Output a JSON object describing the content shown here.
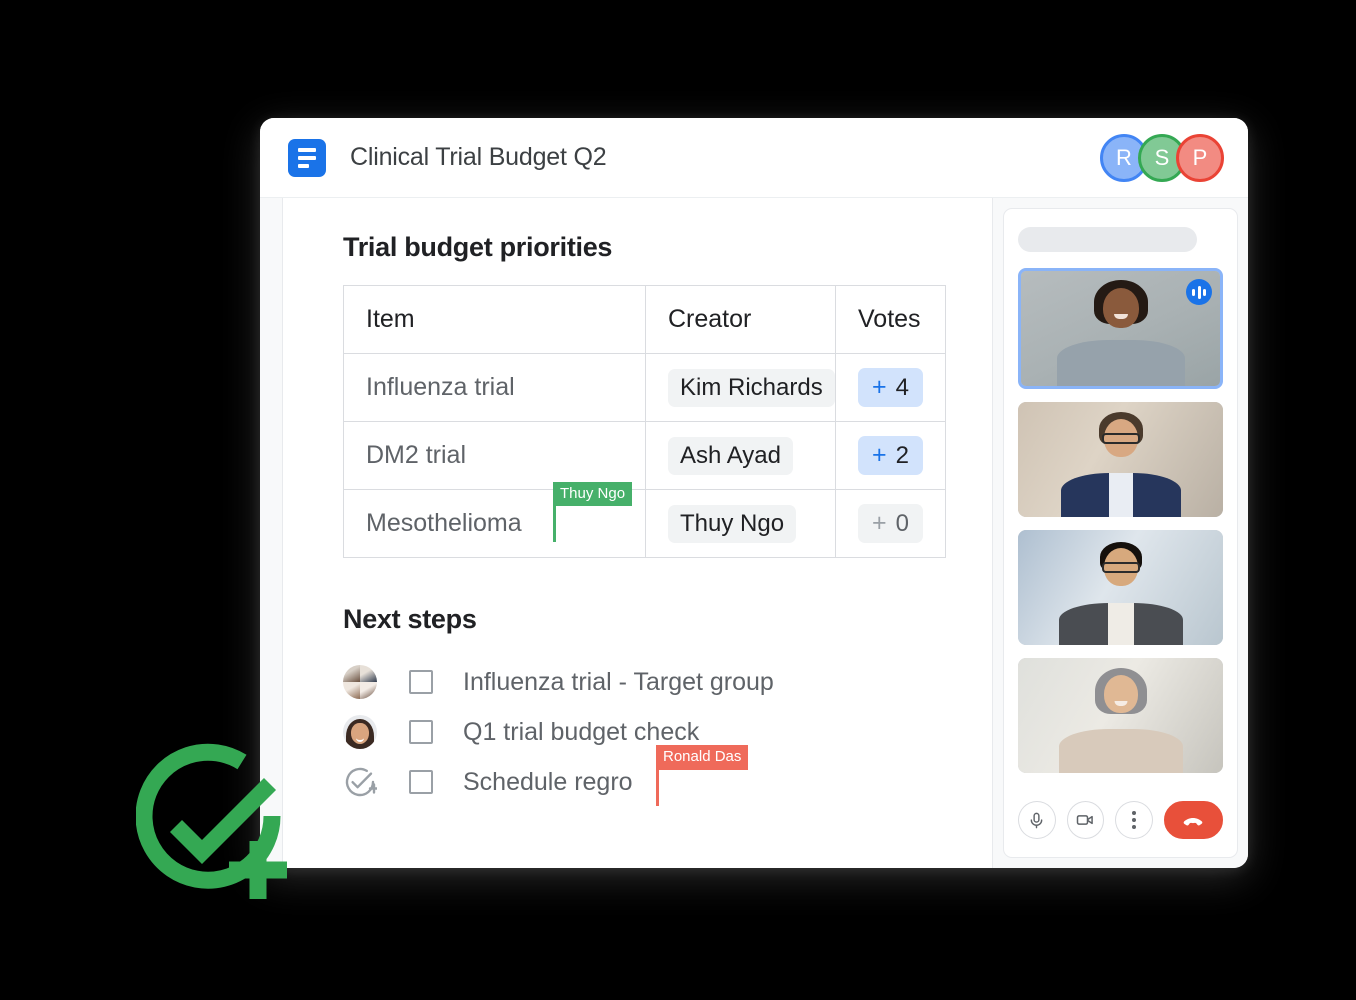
{
  "header": {
    "doc_icon": "google-docs-icon",
    "title": "Clinical Trial Budget Q2",
    "avatars": [
      {
        "initial": "R",
        "color": "#8ab4f8",
        "ring": "#4285f4"
      },
      {
        "initial": "S",
        "color": "#81c995",
        "ring": "#34a853"
      },
      {
        "initial": "P",
        "color": "#f28b82",
        "ring": "#ea4335"
      }
    ]
  },
  "document": {
    "section_title": "Trial budget priorities",
    "table": {
      "columns": [
        "Item",
        "Creator",
        "Votes"
      ],
      "rows": [
        {
          "item": "Influenza trial",
          "creator": "Kim Richards",
          "vote_plus": "+",
          "votes": "4",
          "votes_active": true
        },
        {
          "item": "DM2 trial",
          "creator": "Ash Ayad",
          "vote_plus": "+",
          "votes": "2",
          "votes_active": true
        },
        {
          "item": "Mesothelioma",
          "creator": "Thuy Ngo",
          "vote_plus": "+",
          "votes": "0",
          "votes_active": false
        }
      ]
    },
    "cursors": [
      {
        "name": "Thuy Ngo",
        "color": "#46b06a"
      },
      {
        "name": "Ronald Das",
        "color": "#ef6a5a"
      }
    ],
    "next_steps_title": "Next steps",
    "tasks": [
      {
        "label": "Influenza trial - Target group",
        "avatar": "group-avatar",
        "checked": false
      },
      {
        "label": "Q1 trial budget check",
        "avatar": "person-avatar",
        "checked": false
      },
      {
        "label": "Schedule regro",
        "avatar": "add-task-icon",
        "checked": false
      }
    ]
  },
  "meet_panel": {
    "participants": [
      {
        "name": "participant-1",
        "speaking": true
      },
      {
        "name": "participant-2",
        "speaking": false
      },
      {
        "name": "participant-3",
        "speaking": false
      },
      {
        "name": "participant-4",
        "speaking": false
      }
    ],
    "controls": [
      {
        "name": "microphone-button",
        "icon": "microphone-icon"
      },
      {
        "name": "camera-button",
        "icon": "video-camera-icon"
      },
      {
        "name": "more-options-button",
        "icon": "three-dots-icon"
      },
      {
        "name": "hang-up-button",
        "icon": "phone-hangup-icon"
      }
    ]
  },
  "brand": {
    "logo": "green-add-task-icon",
    "color": "#34a853"
  }
}
